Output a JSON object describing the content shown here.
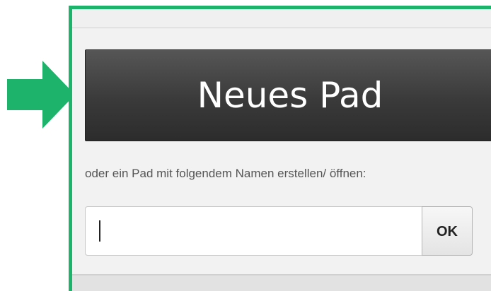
{
  "new_pad_button": {
    "label": "Neues Pad"
  },
  "hint": {
    "text": "oder ein Pad mit folgendem Namen erstellen/ öffnen:"
  },
  "pad_name_input": {
    "value": "",
    "placeholder": ""
  },
  "ok_button": {
    "label": "OK"
  },
  "annotation": {
    "arrow_icon": "right-arrow-icon",
    "arrow_color": "#1db36b",
    "frame_color": "#1db36b"
  },
  "colors": {
    "button_dark": "#3a3a3a",
    "panel_bg": "#f2f2f2",
    "hint_text": "#555555"
  }
}
